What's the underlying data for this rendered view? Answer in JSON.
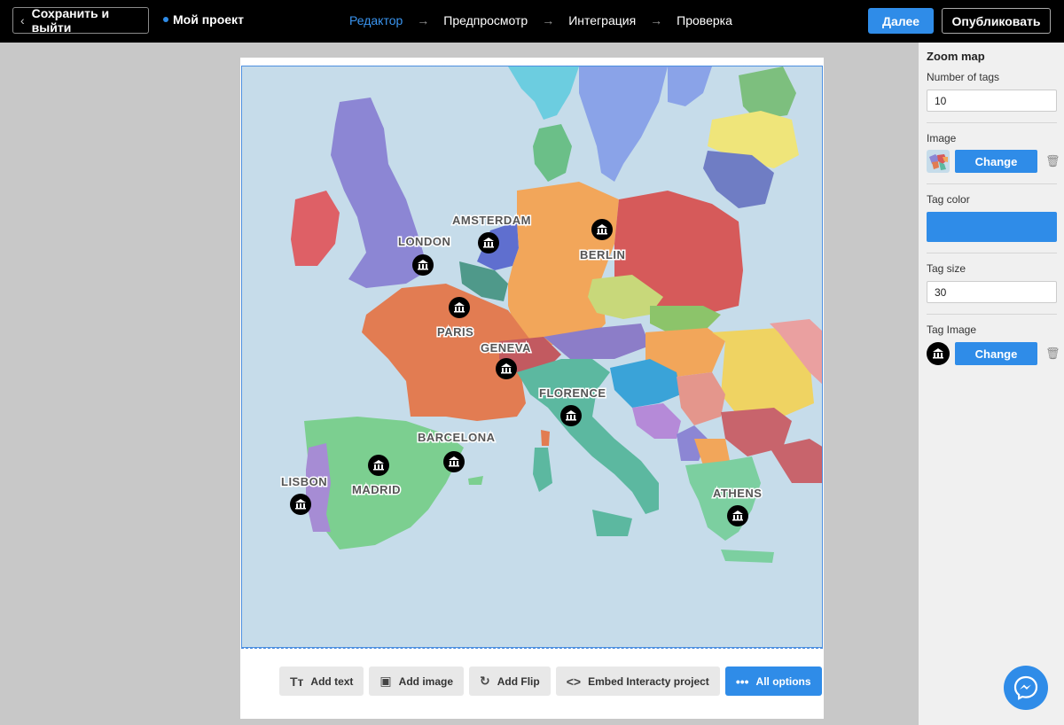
{
  "topbar": {
    "save_exit": "Сохранить и выйти",
    "project_name": "Мой проект",
    "steps": [
      "Редактор",
      "Предпросмотр",
      "Интеграция",
      "Проверка"
    ],
    "next": "Далее",
    "publish": "Опубликовать"
  },
  "map": {
    "cities": [
      "AMSTERDAM",
      "LONDON",
      "BERLIN",
      "PARIS",
      "GENEVA",
      "FLORENCE",
      "BARCELONA",
      "LISBON",
      "MADRID",
      "ATHENS"
    ],
    "tag_icon": "museum-icon"
  },
  "toolbar": {
    "add_text": "Add text",
    "add_image": "Add image",
    "add_flip": "Add Flip",
    "embed": "Embed Interacty project",
    "all_options": "All options"
  },
  "panel": {
    "title": "Zoom map",
    "number_of_tags_label": "Number of tags",
    "number_of_tags": "10",
    "image_label": "Image",
    "change": "Change",
    "tag_color_label": "Tag color",
    "tag_color": "#2f8ce8",
    "tag_size_label": "Tag size",
    "tag_size": "30",
    "tag_image_label": "Tag Image"
  }
}
